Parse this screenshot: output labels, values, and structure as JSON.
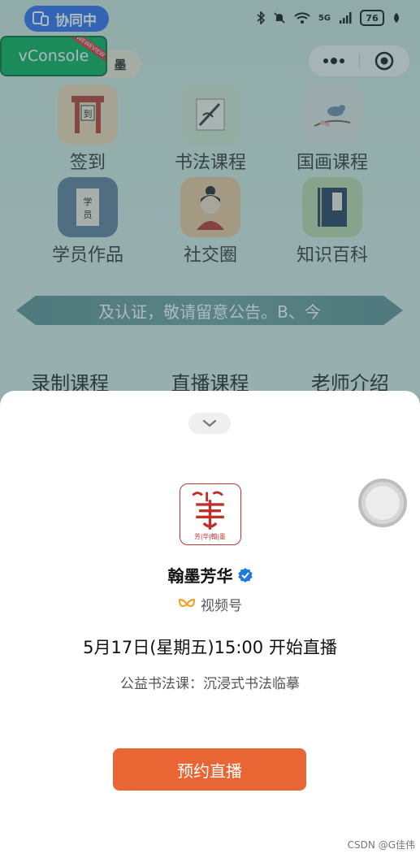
{
  "status_bar": {
    "sync_label": "协同中",
    "network": "5G",
    "battery": "76"
  },
  "vconsole": {
    "label": "vConsole",
    "ribbon": "WEWEVIEW"
  },
  "mini_program": {
    "title_fragment": "墨"
  },
  "grid": {
    "items": [
      {
        "label": "签到",
        "icon": "sign-in-icon"
      },
      {
        "label": "书法课程",
        "icon": "calligraphy-icon"
      },
      {
        "label": "国画课程",
        "icon": "painting-icon"
      },
      {
        "label": "学员作品",
        "icon": "student-works-icon"
      },
      {
        "label": "社交圈",
        "icon": "social-circle-icon"
      },
      {
        "label": "知识百科",
        "icon": "encyclopedia-icon"
      }
    ]
  },
  "banner": {
    "text": "及认证，敬请留意公告。B、今"
  },
  "tabs": [
    "录制课程",
    "直播课程",
    "老师介绍"
  ],
  "sheet": {
    "avatar_caption": "芳|华|翰|墨",
    "channel_name": "翰墨芳华",
    "platform": "视频号",
    "live_time": "5月17日(星期五)15:00 开始直播",
    "live_desc": "公益书法课：沉浸式书法临摹",
    "reserve_button": "预约直播"
  },
  "colors": {
    "accent": "#ea6534",
    "sync_pill": "#2f6cf0",
    "vconsole": "#06ae56"
  },
  "watermark": "CSDN @G佳伟"
}
